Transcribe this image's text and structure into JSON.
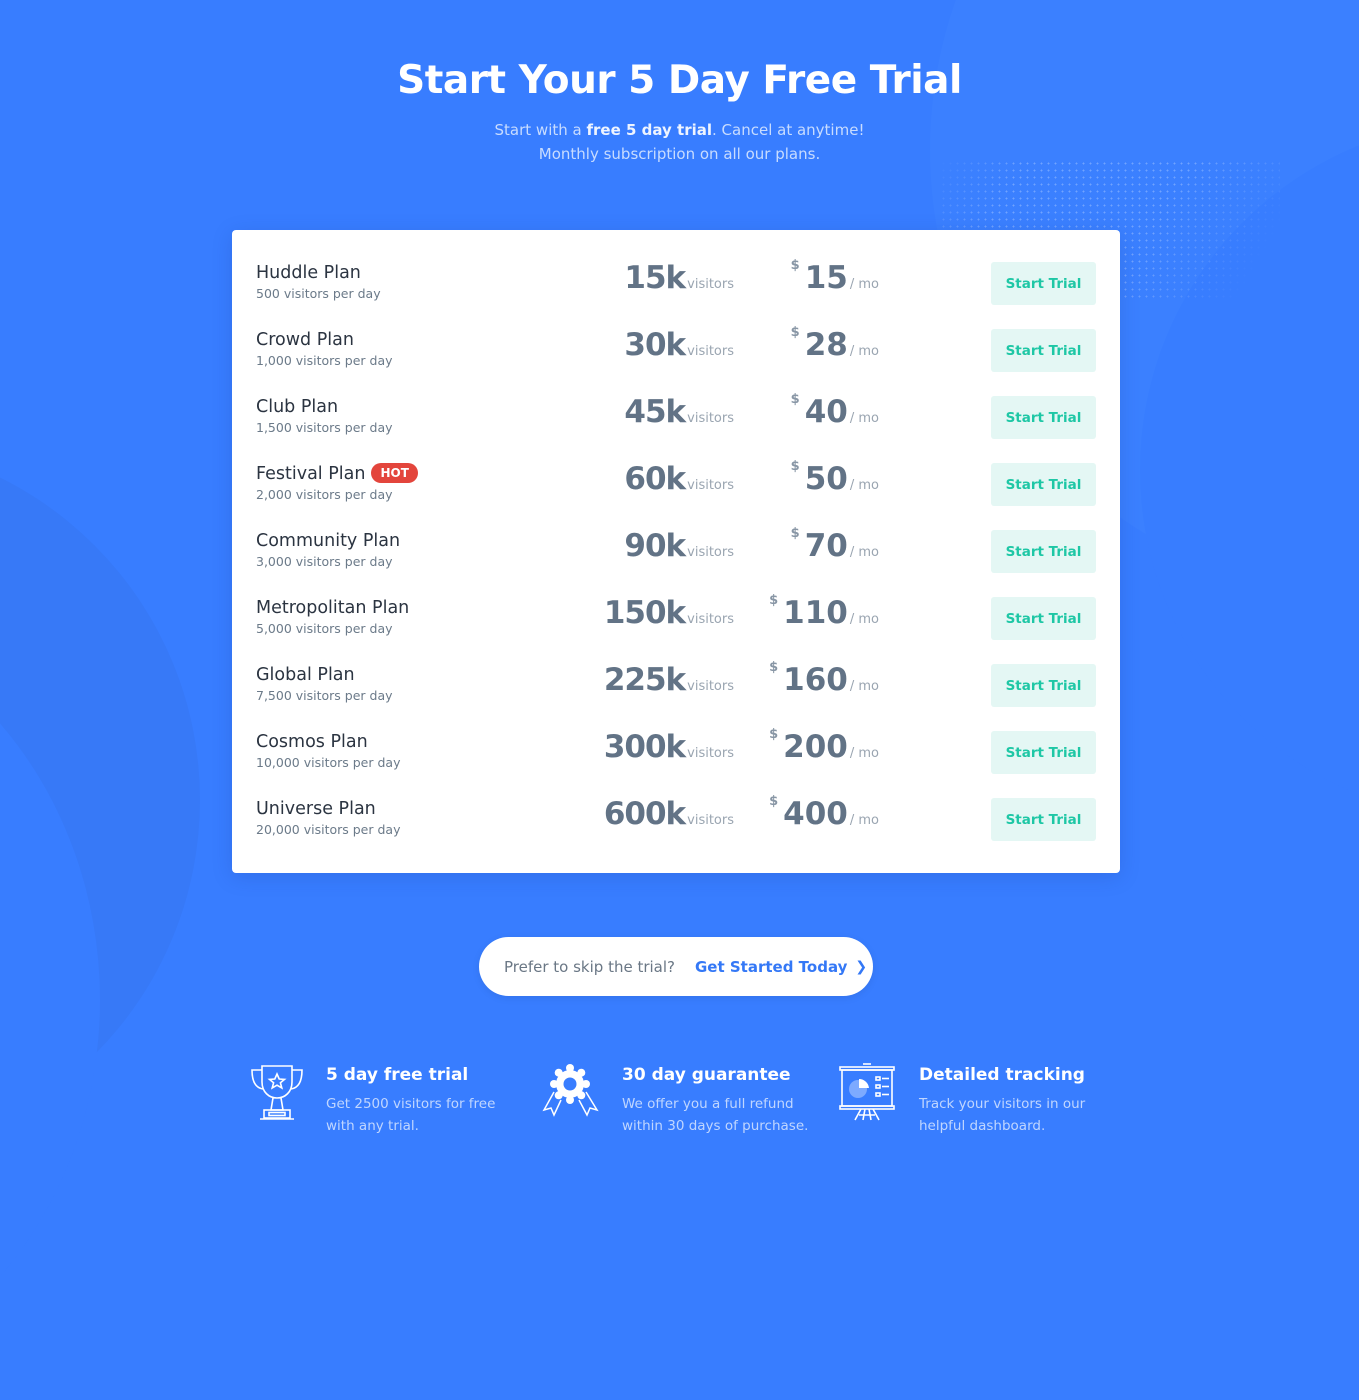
{
  "header": {
    "title": "Start Your 5 Day Free Trial",
    "subtitle_pre": "Start with a ",
    "subtitle_bold": "free 5 day trial",
    "subtitle_post": ". Cancel at anytime!",
    "subtitle_line2": "Monthly subscription on all our plans."
  },
  "colors": {
    "background": "#387dff",
    "accent_teal": "#1ec7a5",
    "button_bg": "#e4f7f4",
    "hot_badge": "#e3453c",
    "link_blue": "#3478f6"
  },
  "plans": [
    {
      "name": "Huddle Plan",
      "desc": "500 visitors per day",
      "visitors": "15k",
      "visitors_unit": "visitors",
      "currency": "$",
      "price": "15",
      "period": "/ mo",
      "button": "Start Trial",
      "badge": null
    },
    {
      "name": "Crowd Plan",
      "desc": "1,000 visitors per day",
      "visitors": "30k",
      "visitors_unit": "visitors",
      "currency": "$",
      "price": "28",
      "period": "/ mo",
      "button": "Start Trial",
      "badge": null
    },
    {
      "name": "Club Plan",
      "desc": "1,500 visitors per day",
      "visitors": "45k",
      "visitors_unit": "visitors",
      "currency": "$",
      "price": "40",
      "period": "/ mo",
      "button": "Start Trial",
      "badge": null
    },
    {
      "name": "Festival Plan",
      "desc": "2,000 visitors per day",
      "visitors": "60k",
      "visitors_unit": "visitors",
      "currency": "$",
      "price": "50",
      "period": "/ mo",
      "button": "Start Trial",
      "badge": "HOT"
    },
    {
      "name": "Community Plan",
      "desc": "3,000 visitors per day",
      "visitors": "90k",
      "visitors_unit": "visitors",
      "currency": "$",
      "price": "70",
      "period": "/ mo",
      "button": "Start Trial",
      "badge": null
    },
    {
      "name": "Metropolitan Plan",
      "desc": "5,000 visitors per day",
      "visitors": "150k",
      "visitors_unit": "visitors",
      "currency": "$",
      "price": "110",
      "period": "/ mo",
      "button": "Start Trial",
      "badge": null
    },
    {
      "name": "Global Plan",
      "desc": "7,500 visitors per day",
      "visitors": "225k",
      "visitors_unit": "visitors",
      "currency": "$",
      "price": "160",
      "period": "/ mo",
      "button": "Start Trial",
      "badge": null
    },
    {
      "name": "Cosmos Plan",
      "desc": "10,000 visitors per day",
      "visitors": "300k",
      "visitors_unit": "visitors",
      "currency": "$",
      "price": "200",
      "period": "/ mo",
      "button": "Start Trial",
      "badge": null
    },
    {
      "name": "Universe Plan",
      "desc": "20,000 visitors per day",
      "visitors": "600k",
      "visitors_unit": "visitors",
      "currency": "$",
      "price": "400",
      "period": "/ mo",
      "button": "Start Trial",
      "badge": null
    }
  ],
  "cta": {
    "text": "Prefer to skip the trial?",
    "link": "Get Started Today",
    "chevron_icon": "chevron-right-icon"
  },
  "features": [
    {
      "icon": "trophy-icon",
      "title": "5 day free trial",
      "desc": "Get 2500 visitors for free with any trial."
    },
    {
      "icon": "award-ribbon-icon",
      "title": "30 day guarantee",
      "desc": "We offer you a full refund within 30 days of purchase."
    },
    {
      "icon": "presentation-board-icon",
      "title": "Detailed tracking",
      "desc": "Track your visitors in our helpful dashboard."
    }
  ]
}
